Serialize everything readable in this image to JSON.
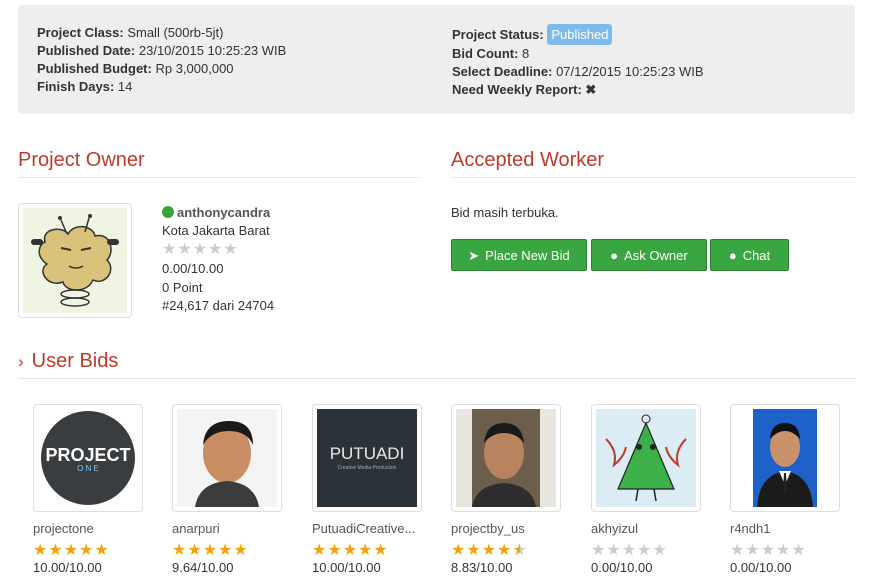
{
  "project_info": {
    "class_label": "Project Class:",
    "class_value": "Small (500rb-5jt)",
    "published_date_label": "Published Date:",
    "published_date_value": "23/10/2015 10:25:23 WIB",
    "budget_label": "Published Budget:",
    "budget_value": "Rp 3,000,000",
    "finish_days_label": "Finish Days:",
    "finish_days_value": "14",
    "status_label": "Project Status:",
    "status_value": "Published",
    "bid_count_label": "Bid Count:",
    "bid_count_value": "8",
    "deadline_label": "Select Deadline:",
    "deadline_value": "07/12/2015 10:25:23 WIB",
    "weekly_report_label": "Need Weekly Report:",
    "weekly_report_icon": "times-icon"
  },
  "owner": {
    "section_title": "Project Owner",
    "username": "anthonycandra",
    "location": "Kota Jakarta Barat",
    "rating_stars": 0,
    "score": "0.00/10.00",
    "points": "0 Point",
    "rank": "#24,617 dari 24704",
    "status_color": "#3aa63a"
  },
  "accepted_worker": {
    "section_title": "Accepted Worker",
    "message": "Bid masih terbuka.",
    "buttons": [
      {
        "label": "Place New Bid",
        "icon": "paper-plane-icon"
      },
      {
        "label": "Ask Owner",
        "icon": "comment-icon"
      },
      {
        "label": "Chat",
        "icon": "comments-icon"
      }
    ]
  },
  "user_bids": {
    "section_title": "User Bids",
    "bids": [
      {
        "name": "projectone",
        "stars": 5,
        "score": "10.00/10.00"
      },
      {
        "name": "anarpuri",
        "stars": 5,
        "score": "9.64/10.00"
      },
      {
        "name": "PutuadiCreative...",
        "stars": 5,
        "score": "10.00/10.00"
      },
      {
        "name": "projectby_us",
        "stars": 4.5,
        "score": "8.83/10.00"
      },
      {
        "name": "akhyizul",
        "stars": 0,
        "score": "0.00/10.00"
      },
      {
        "name": "r4ndh1",
        "stars": 0,
        "score": "0.00/10.00"
      }
    ]
  },
  "colors": {
    "accent_red": "#c0392b",
    "button_green": "#3aa641",
    "badge_blue": "#7ebbec",
    "star_gold": "#f0a30a"
  }
}
